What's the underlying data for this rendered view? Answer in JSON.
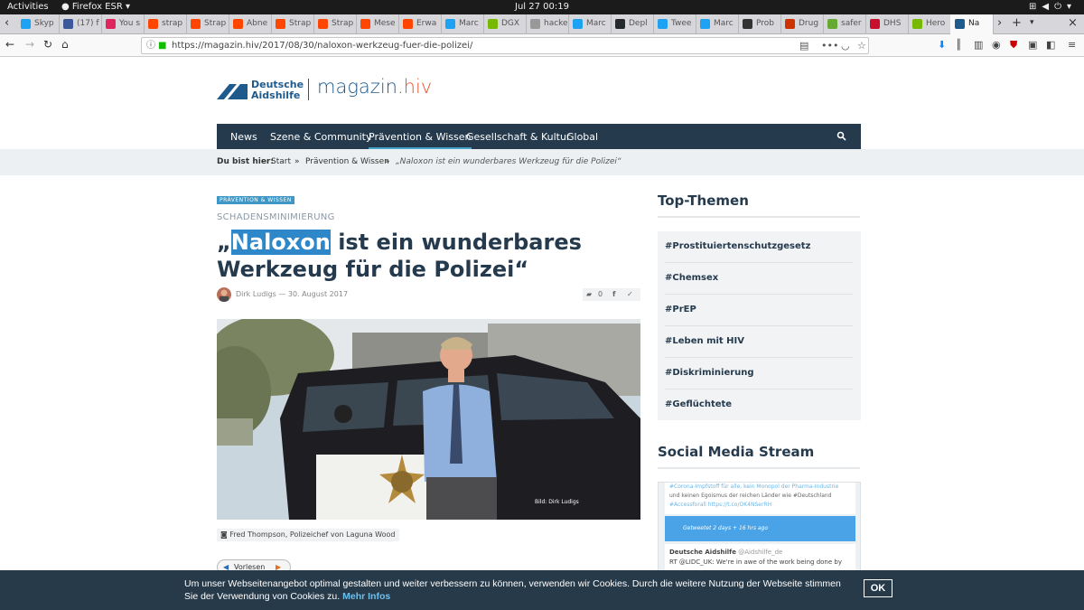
{
  "system_bar": {
    "activities": "Activities",
    "app": "Firefox ESR ▾",
    "clock": "Jul 27  00:19"
  },
  "tabs": [
    {
      "label": "Skyp",
      "color": "#1da1f2"
    },
    {
      "label": "(17) f",
      "color": "#3b5998"
    },
    {
      "label": "You s",
      "color": "#e0245e"
    },
    {
      "label": "strap",
      "color": "#ff4500"
    },
    {
      "label": "Strap",
      "color": "#ff4500"
    },
    {
      "label": "Abne",
      "color": "#ff4500"
    },
    {
      "label": "Strap",
      "color": "#ff4500"
    },
    {
      "label": "Strap",
      "color": "#ff4500"
    },
    {
      "label": "Mese",
      "color": "#ff4500"
    },
    {
      "label": "Erwa",
      "color": "#ff4500"
    },
    {
      "label": "Marc",
      "color": "#1da1f2"
    },
    {
      "label": "DGX",
      "color": "#76b900"
    },
    {
      "label": "hackers",
      "color": "#999999"
    },
    {
      "label": "Marc",
      "color": "#1da1f2"
    },
    {
      "label": "Depl",
      "color": "#24292e"
    },
    {
      "label": "Twee",
      "color": "#1da1f2"
    },
    {
      "label": "Marc",
      "color": "#1da1f2"
    },
    {
      "label": "Prob",
      "color": "#333333"
    },
    {
      "label": "Drug",
      "color": "#cc3300"
    },
    {
      "label": "safer",
      "color": "#66aa33"
    },
    {
      "label": "DHS",
      "color": "#c8102e"
    },
    {
      "label": "Hero",
      "color": "#76b900"
    },
    {
      "label": "Na",
      "color": "#1f5a8c"
    }
  ],
  "url": "https://magazin.hiv/2017/08/30/naloxon-werkzeug-fuer-die-polizei/",
  "logo": {
    "org_line1": "Deutsche",
    "org_line2": "Aidshilfe",
    "site": "magazin.",
    "site_accent": "hiv"
  },
  "nav": [
    "News",
    "Szene & Community",
    "Prävention & Wissen",
    "Gesellschaft & Kultur",
    "Global"
  ],
  "breadcrumb": {
    "label": "Du bist hier:",
    "items": [
      "Start",
      "»",
      "Prävention & Wissen",
      "»",
      "„Naloxon ist ein wunderbares Werkzeug für die Polizei“"
    ]
  },
  "article": {
    "badge": "PRÄVENTION & WISSEN",
    "kicker": "SCHADENSMINIMIERUNG",
    "title_pre": "„",
    "title_highlight": "Naloxon",
    "title_post": " ist ein wunderbares Werkzeug für die Polizei“",
    "byline": "Dirk Ludigs — 30. August 2017",
    "comments": "0",
    "photo_credit": "Bild: Dirk Ludigs",
    "caption": "Fred Thompson, Polizeichef von Laguna Wood",
    "read_label": "Vorlesen"
  },
  "sidebar": {
    "top_heading": "Top-Themen",
    "topics": [
      "#Prostituiertenschutzgesetz",
      "#Chemsex",
      "#PrEP",
      "#Leben mit HIV",
      "#Diskriminierung",
      "#Geflüchtete"
    ],
    "stream_heading": "Social Media Stream",
    "tweet1_line1": "#Corona-Impfstoff für alle, kein Monopol der Pharma-Industrie",
    "tweet1_line2": "und keinen Egoismus der reichen Länder wie #Deutschland",
    "tweet1_line3": "#Accessforall https://t.co/OK4NSerRH",
    "tweet1_meta": "Getweetet  2 days + 16 hrs ago",
    "tweet2_author": "Deutsche Aidshilfe",
    "tweet2_handle": "@Aidshilfe_de",
    "tweet2_text": "RT @LIDC_UK: We're in awe of the work being done by"
  },
  "cookie": {
    "text": "Um unser Webseitenangebot optimal gestalten und weiter verbessern zu können, verwenden wir Cookies. Durch die weitere Nutzung der Webseite stimmen Sie der Verwendung von Cookies zu.",
    "more": "Mehr Infos",
    "ok": "OK"
  }
}
